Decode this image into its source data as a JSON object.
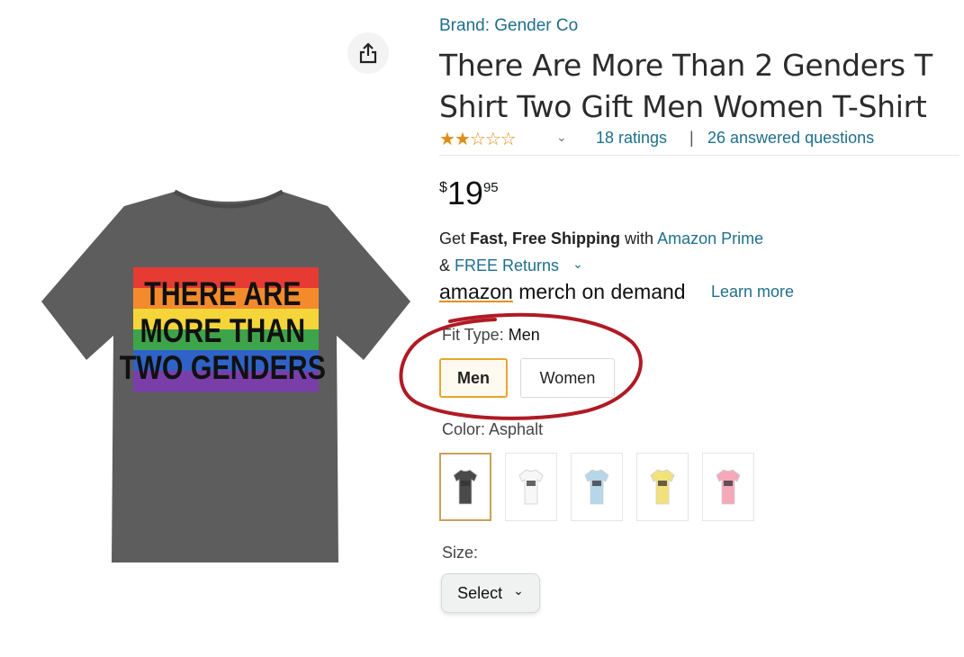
{
  "brand": {
    "label": "Brand: Gender Co"
  },
  "product": {
    "title": "There Are More Than 2 Genders T Shirt Two Gift Men Women T-Shirt",
    "image_text": [
      "THERE ARE",
      "MORE THAN",
      "TWO GENDERS"
    ],
    "flag_colors": [
      "#e63b32",
      "#f38b2c",
      "#f4d53a",
      "#3ea44b",
      "#2f63c7",
      "#7a3ea9"
    ],
    "shirt_color": "#5d5d5d"
  },
  "rating": {
    "stars_filled": 2,
    "stars_total": 5,
    "ratings_label": "18 ratings",
    "separator": "|",
    "answers_label": "26 answered questions"
  },
  "price": {
    "symbol": "$",
    "whole": "19",
    "fraction": "95"
  },
  "shipping": {
    "line1_prefix": "Get ",
    "line1_bold": "Fast, Free Shipping",
    "line1_mid": " with ",
    "line1_link": "Amazon Prime",
    "line2_prefix": "& ",
    "line2_link": "FREE Returns",
    "merch_amazon": "amazon",
    "merch_rest": " merch on demand",
    "learn_more": "Learn more"
  },
  "fit": {
    "label": "Fit Type: ",
    "selected": "Men",
    "options": [
      "Men",
      "Women"
    ]
  },
  "color": {
    "label": "Color: ",
    "selected": "Asphalt",
    "swatches": [
      "#4a4a4a",
      "#f7f7f7",
      "#b6d6ea",
      "#f3e27a",
      "#f4a8b8"
    ]
  },
  "size": {
    "label": "Size:",
    "select_label": "Select"
  },
  "icons": {
    "share": "share-icon",
    "chevron": "chevron-down-icon",
    "star": "star-icon"
  },
  "annotation_color": "#b01a24"
}
